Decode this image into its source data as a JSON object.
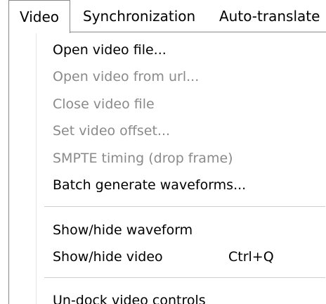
{
  "menubar": {
    "items": [
      {
        "label": "Video"
      },
      {
        "label": "Synchronization"
      },
      {
        "label": "Auto-translate"
      }
    ]
  },
  "video_menu": {
    "items": [
      {
        "label": "Open video file...",
        "enabled": true
      },
      {
        "label": "Open video from url...",
        "enabled": false
      },
      {
        "label": "Close video file",
        "enabled": false
      },
      {
        "label": "Set video offset...",
        "enabled": false
      },
      {
        "label": "SMPTE timing (drop frame)",
        "enabled": false
      },
      {
        "label": "Batch generate waveforms...",
        "enabled": true
      },
      {
        "label": "Show/hide waveform",
        "enabled": true
      },
      {
        "label": "Show/hide video",
        "enabled": true,
        "shortcut": "Ctrl+Q"
      },
      {
        "label": "Un-dock video controls",
        "enabled": true
      }
    ]
  }
}
